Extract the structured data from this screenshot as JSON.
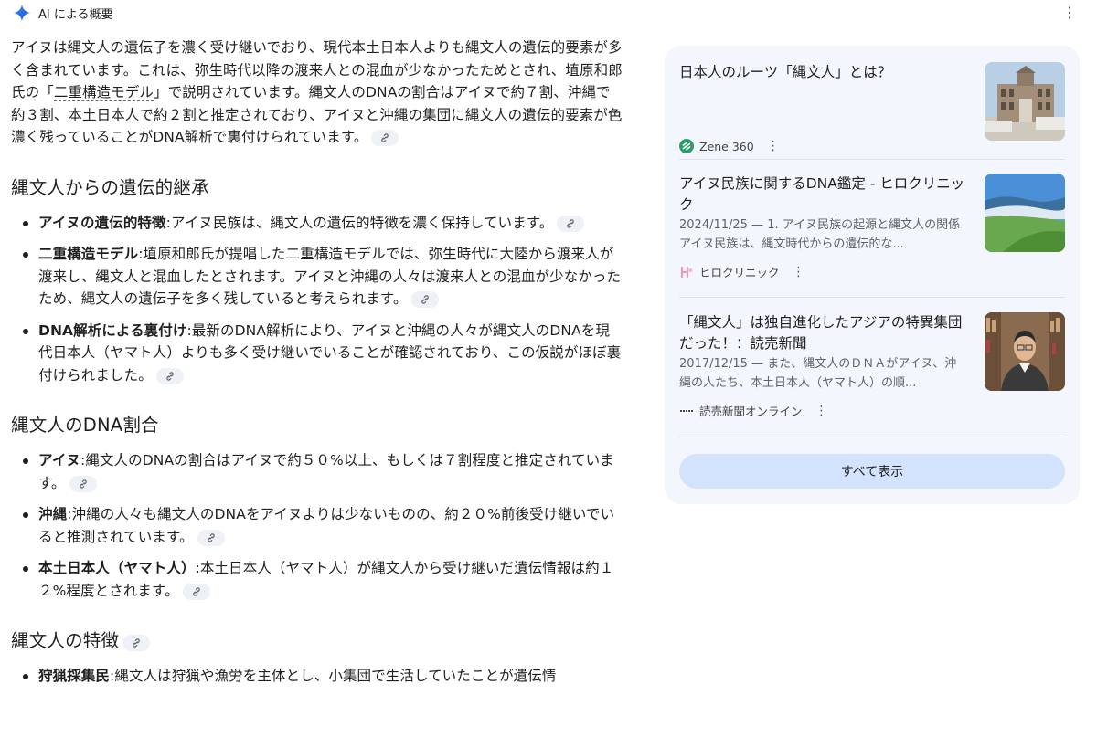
{
  "header": {
    "title": "AI による概要",
    "menu_icon": "more-vert-icon"
  },
  "intro": {
    "p1": "アイヌは縄文人の遺伝子を濃く受け継いでおり、現代本土日本人よりも縄文人の遺伝的要素が多く含まれています。これは、弥生時代以降の渡来人との混血が少なかったためとされ、埴原和郎氏の「",
    "p_link": "二重構造モデル",
    "p2": "」で説明されています。縄文人のDNAの割合はアイヌで約７割、沖縄で約３割、本土日本人で約２割と推定されており、アイヌと沖縄の集団に縄文人の遺伝的要素が色濃く残っていることがDNA解析で裏付けられています。"
  },
  "sections": [
    {
      "heading": "縄文人からの遺伝的継承",
      "items": [
        {
          "bold": "アイヌの遺伝的特徴",
          "text": ":アイヌ民族は、縄文人の遺伝的特徴を濃く保持しています。"
        },
        {
          "bold": "二重構造モデル",
          "text": ":埴原和郎氏が提唱した二重構造モデルでは、弥生時代に大陸から渡来人が渡来し、縄文人と混血したとされます。アイヌと沖縄の人々は渡来人との混血が少なかったため、縄文人の遺伝子を多く残していると考えられます。"
        },
        {
          "bold": "DNA解析による裏付け",
          "text": ":最新のDNA解析により、アイヌと沖縄の人々が縄文人のDNAを現代日本人（ヤマト人）よりも多く受け継いでいることが確認されており、この仮説がほぼ裏付けられました。"
        }
      ]
    },
    {
      "heading": "縄文人のDNA割合",
      "items": [
        {
          "bold": "アイヌ",
          "text": ":縄文人のDNAの割合はアイヌで約５０%以上、もしくは７割程度と推定されています。"
        },
        {
          "bold": "沖縄",
          "text": ":沖縄の人々も縄文人のDNAをアイヌよりは少ないものの、約２０%前後受け継いでいると推測されています。"
        },
        {
          "bold": "本土日本人（ヤマト人）",
          "text": ":本土日本人（ヤマト人）が縄文人から受け継いだ遺伝情報は約１２%程度とされます。"
        }
      ]
    },
    {
      "heading": "縄文人の特徴",
      "items": [
        {
          "bold": "狩猟採集民",
          "text": ":縄文人は狩猟や漁労を主体とし、小集団で生活していたことが遺伝情"
        }
      ]
    }
  ],
  "sources": [
    {
      "title": "日本人のルーツ「縄文人」とは？",
      "snippet": "",
      "site": "Zene 360",
      "site_icon": "zene-icon",
      "thumb": "building-photo"
    },
    {
      "title": "アイヌ民族に関するDNA鑑定 - ヒロクリニック",
      "snippet": "2024/11/25 — 1. アイヌ民族の起源と縄文人の関係 アイヌ民族は、縄文時代からの遺伝的な...",
      "site": "ヒロクリニック",
      "site_icon": "hiro-clinic-icon",
      "thumb": "landscape-photo"
    },
    {
      "title": "「縄文人」は独自進化したアジアの特異集団だった！：読売新聞",
      "snippet": "2017/12/15 — また、縄文人のＤＮＡがアイヌ、沖縄の人たち、本土日本人（ヤマト人）の順...",
      "site": "読売新聞オンライン",
      "site_icon": "yomiuri-icon",
      "thumb": "portrait-photo"
    }
  ],
  "show_all_label": "すべて表示",
  "colors": {
    "accent": "#1a73e8",
    "panel_bg": "#f3f6fc",
    "button_bg": "#d3e3fd",
    "chip_bg": "#eef1f6"
  }
}
